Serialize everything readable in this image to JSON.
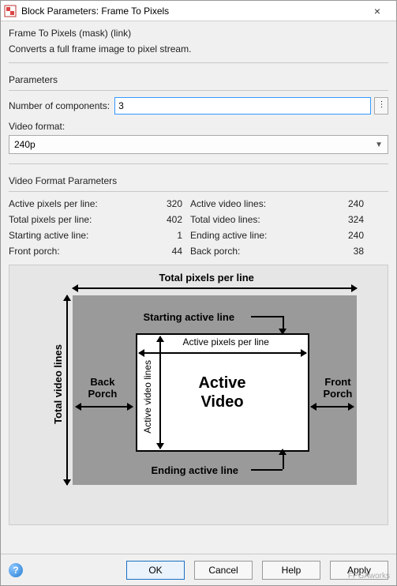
{
  "window": {
    "title": "Block Parameters: Frame To Pixels",
    "close": "×"
  },
  "mask_label": "Frame To Pixels (mask) (link)",
  "description": "Converts a full frame image to pixel stream.",
  "params_section_title": "Parameters",
  "num_components_label": "Number of components:",
  "num_components_value": "3",
  "extra_btn": "⋮",
  "video_format_label": "Video format:",
  "video_format_value": "240p",
  "video_params_title": "Video Format Parameters",
  "vp": {
    "active_pixels_label": "Active pixels per line:",
    "active_pixels_val": "320",
    "active_lines_label": "Active video lines:",
    "active_lines_val": "240",
    "total_pixels_label": "Total pixels per line:",
    "total_pixels_val": "402",
    "total_lines_label": "Total video lines:",
    "total_lines_val": "324",
    "start_line_label": "Starting active line:",
    "start_line_val": "1",
    "end_line_label": "Ending active line:",
    "end_line_val": "240",
    "front_porch_label": "Front porch:",
    "front_porch_val": "44",
    "back_porch_label": "Back porch:",
    "back_porch_val": "38"
  },
  "diagram": {
    "total_pixels": "Total pixels per line",
    "total_lines": "Total video lines",
    "start_line": "Starting active line",
    "end_line": "Ending active line",
    "active_pixels": "Active pixels per line",
    "active_lines": "Active video lines",
    "back_porch": "Back\nPorch",
    "front_porch": "Front\nPorch",
    "active_video": "Active\nVideo"
  },
  "buttons": {
    "ok": "OK",
    "cancel": "Cancel",
    "help": "Help",
    "apply": "Apply"
  },
  "watermark": "FPGAworks"
}
